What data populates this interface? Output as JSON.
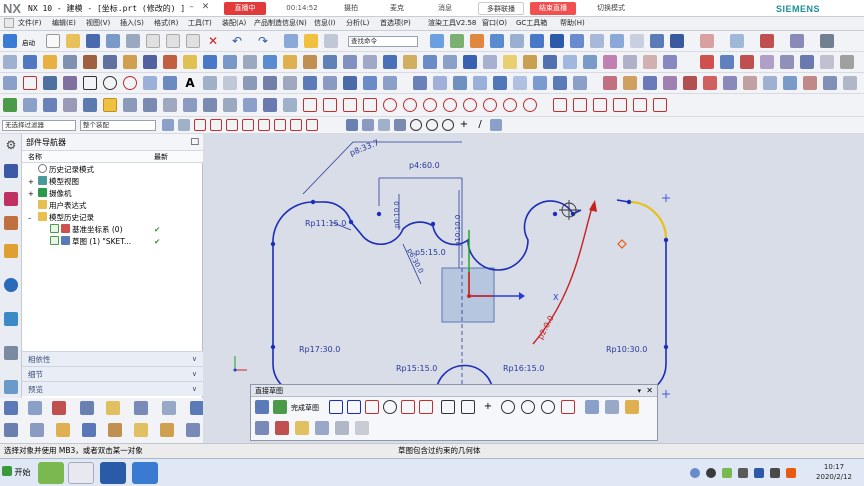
{
  "titlebar": {
    "logo": "NX",
    "title": "NX 10 - 建模 - [坐标.prt  (修改的) ]",
    "brand": "SIEMENS",
    "live": {
      "status": "直播中",
      "timer": "00:14:52",
      "tool1": "摄拍",
      "tool2": "麦克",
      "tool3": "消息",
      "tool4": "多群联播",
      "end": "结束直播",
      "mode": "切换模式"
    }
  },
  "menu": [
    "文件(F)",
    "编辑(E)",
    "视图(V)",
    "插入(S)",
    "格式(R)",
    "工具(T)",
    "装配(A)",
    "产品制造信息(N)",
    "信息(I)",
    "分析(L)",
    "首选项(P)",
    "窗口(O)",
    "GC工具箱",
    "帮助(H)"
  ],
  "menu_extra": "渲染工具V2.58",
  "toolbar": {
    "start_label": "启动",
    "search_placeholder": "查找命令",
    "filter_value": "无选择过滤器",
    "assembly_value": "整个装配"
  },
  "navigator": {
    "title": "部件导航器",
    "col_name": "名称",
    "col_latest": "最新",
    "items": [
      {
        "label": "历史记录模式",
        "latest": ""
      },
      {
        "label": "模型视图",
        "latest": ""
      },
      {
        "label": "摄像机",
        "latest": ""
      },
      {
        "label": "用户表达式",
        "latest": ""
      },
      {
        "label": "模型历史记录",
        "latest": ""
      },
      {
        "label": "基准坐标系 (0)",
        "latest": "✔"
      },
      {
        "label": "草图 (1) \"SKET...",
        "latest": "✔"
      }
    ],
    "sections": [
      "相依性",
      "细节",
      "预览"
    ]
  },
  "sketch": {
    "dims": {
      "d1": "p8:33.7",
      "d2": "p4:60.0",
      "d3": "p0:10.0",
      "d4": "p10:10.0",
      "d5": "Rp11:15.0",
      "d6": "p5:15.0",
      "d7": "p6:30.0",
      "d8": "Rp17:30.0",
      "d9": "Rp10:30.0",
      "d10": "Rp15:15.0",
      "d11": "Rp16:15.0",
      "d12": "p2:0.0"
    },
    "axis_x": "X",
    "axis_y": "Y",
    "colors": {
      "sketch": "#1c2db8",
      "dim": "#2a3a9a",
      "axis_red": "#d42020",
      "axis_green": "#1aa21a",
      "axis_blue": "#2a3ad8",
      "datum": "#7a9ac8",
      "highlight": "#e8c21a",
      "ref_red": "#c92020"
    }
  },
  "dialog": {
    "title": "直接草图",
    "finish_label": "完成草图"
  },
  "status": {
    "left": "选择对象并使用 MB3，或者双击某一对象",
    "center": "草图包含过约束的几何体"
  },
  "taskbar": {
    "start": "开始",
    "time": "10:17",
    "date": "2020/2/12"
  }
}
